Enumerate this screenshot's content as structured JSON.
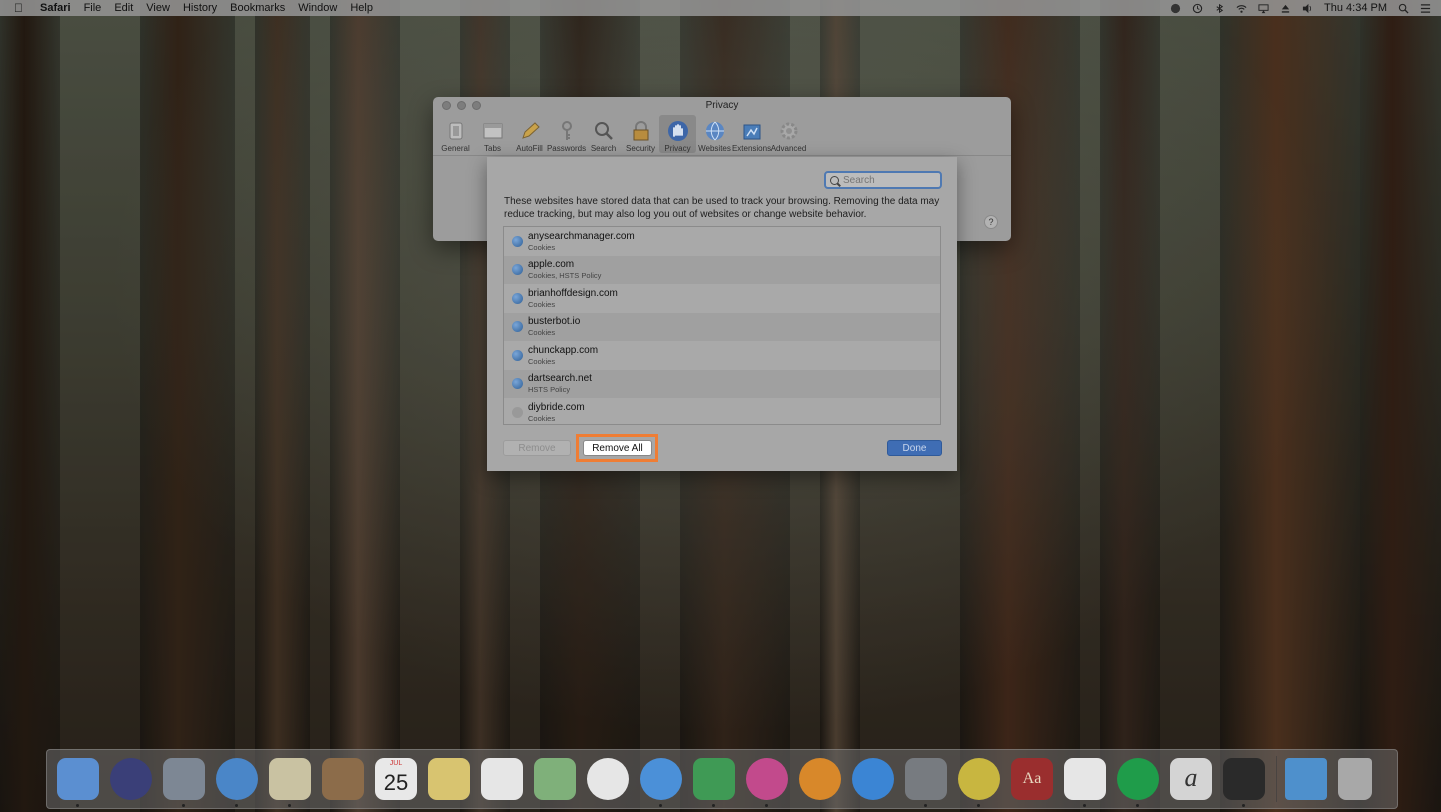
{
  "menubar": {
    "app": "Safari",
    "items": [
      "File",
      "Edit",
      "View",
      "History",
      "Bookmarks",
      "Window",
      "Help"
    ],
    "clock": "Thu 4:34 PM"
  },
  "prefs_window": {
    "title": "Privacy",
    "toolbar": [
      {
        "label": "General",
        "icon": "switch-icon"
      },
      {
        "label": "Tabs",
        "icon": "tabs-icon"
      },
      {
        "label": "AutoFill",
        "icon": "pencil-icon"
      },
      {
        "label": "Passwords",
        "icon": "key-icon"
      },
      {
        "label": "Search",
        "icon": "magnifier-icon"
      },
      {
        "label": "Security",
        "icon": "lock-icon"
      },
      {
        "label": "Privacy",
        "icon": "hand-icon"
      },
      {
        "label": "Websites",
        "icon": "globe-icon"
      },
      {
        "label": "Extensions",
        "icon": "puzzle-icon"
      },
      {
        "label": "Advanced",
        "icon": "gear-icon"
      }
    ],
    "selected": "Privacy",
    "help": "?"
  },
  "sheet": {
    "search_placeholder": "Search",
    "description": "These websites have stored data that can be used to track your browsing. Removing the data may reduce tracking, but may also log you out of websites or change website behavior.",
    "sites": [
      {
        "site": "anysearchmanager.com",
        "kind": "Cookies"
      },
      {
        "site": "apple.com",
        "kind": "Cookies, HSTS Policy"
      },
      {
        "site": "brianhoffdesign.com",
        "kind": "Cookies"
      },
      {
        "site": "busterbot.io",
        "kind": "Cookies"
      },
      {
        "site": "chunckapp.com",
        "kind": "Cookies"
      },
      {
        "site": "dartsearch.net",
        "kind": "HSTS Policy"
      },
      {
        "site": "diybride.com",
        "kind": "Cookies"
      }
    ],
    "remove_label": "Remove",
    "remove_all_label": "Remove All",
    "done_label": "Done"
  },
  "dock": {
    "calendar_month": "JUL",
    "calendar_day": "25",
    "dictionary_glyph": "Aa",
    "signature_glyph": "a",
    "apps": [
      {
        "name": "finder-icon",
        "color": "#5b8fd1"
      },
      {
        "name": "siri-icon",
        "color": "#3a3f78"
      },
      {
        "name": "launchpad-icon",
        "color": "#7d8794"
      },
      {
        "name": "safari-icon",
        "color": "#4a86c8"
      },
      {
        "name": "mail-icon",
        "color": "#c9c2a2"
      },
      {
        "name": "contacts-icon",
        "color": "#8c6c4a"
      },
      {
        "name": "calendar-icon",
        "color": "#e8e8e8"
      },
      {
        "name": "notes-icon",
        "color": "#d8c470"
      },
      {
        "name": "reminders-icon",
        "color": "#e6e6e6"
      },
      {
        "name": "maps-icon",
        "color": "#7fb07a"
      },
      {
        "name": "photos-icon",
        "color": "#e6e6e6"
      },
      {
        "name": "messages-icon",
        "color": "#4b90d8"
      },
      {
        "name": "facetime-icon",
        "color": "#3f9a55"
      },
      {
        "name": "itunes-icon",
        "color": "#c24a8c"
      },
      {
        "name": "ibooks-icon",
        "color": "#d8882a"
      },
      {
        "name": "app-store-icon",
        "color": "#3b85d4"
      },
      {
        "name": "system-preferences-icon",
        "color": "#777b80"
      },
      {
        "name": "chrome-icon",
        "color": "#c8b640"
      },
      {
        "name": "dictionary-icon",
        "color": "#9a2e2e"
      },
      {
        "name": "slack-icon",
        "color": "#e6e6e6"
      },
      {
        "name": "spotify-icon",
        "color": "#1f9c4a"
      },
      {
        "name": "signature-icon",
        "color": "#d4d4d4"
      },
      {
        "name": "activity-monitor-icon",
        "color": "#2a2a2a"
      }
    ],
    "folder_color": "#4e90cc",
    "trash_color": "#a8a8a8"
  }
}
